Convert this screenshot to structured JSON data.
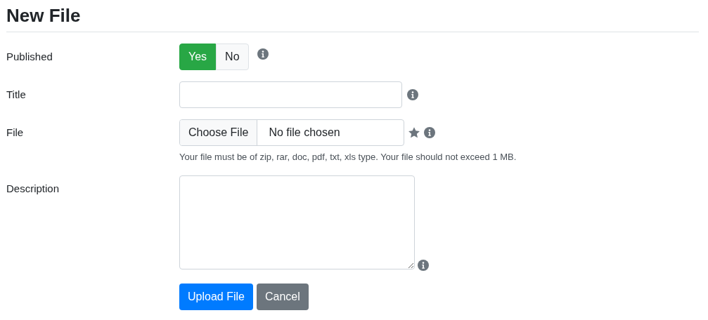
{
  "heading": "New File",
  "fields": [
    {
      "kind": "toggle",
      "label": "Published",
      "options": [
        {
          "label": "Yes",
          "selected": true
        },
        {
          "label": "No",
          "selected": false
        }
      ]
    },
    {
      "kind": "text",
      "label": "Title"
    },
    {
      "kind": "file",
      "label": "File",
      "button": "Choose File",
      "value": "No file chosen",
      "required": true,
      "help": "Your file must be of zip, rar, doc, pdf, txt, xls type. Your file should not exceed 1 MB."
    },
    {
      "kind": "textarea",
      "label": "Description"
    }
  ],
  "buttons": [
    {
      "label": "Upload File",
      "kind": "primary"
    },
    {
      "label": "Cancel",
      "kind": "secondary"
    }
  ]
}
